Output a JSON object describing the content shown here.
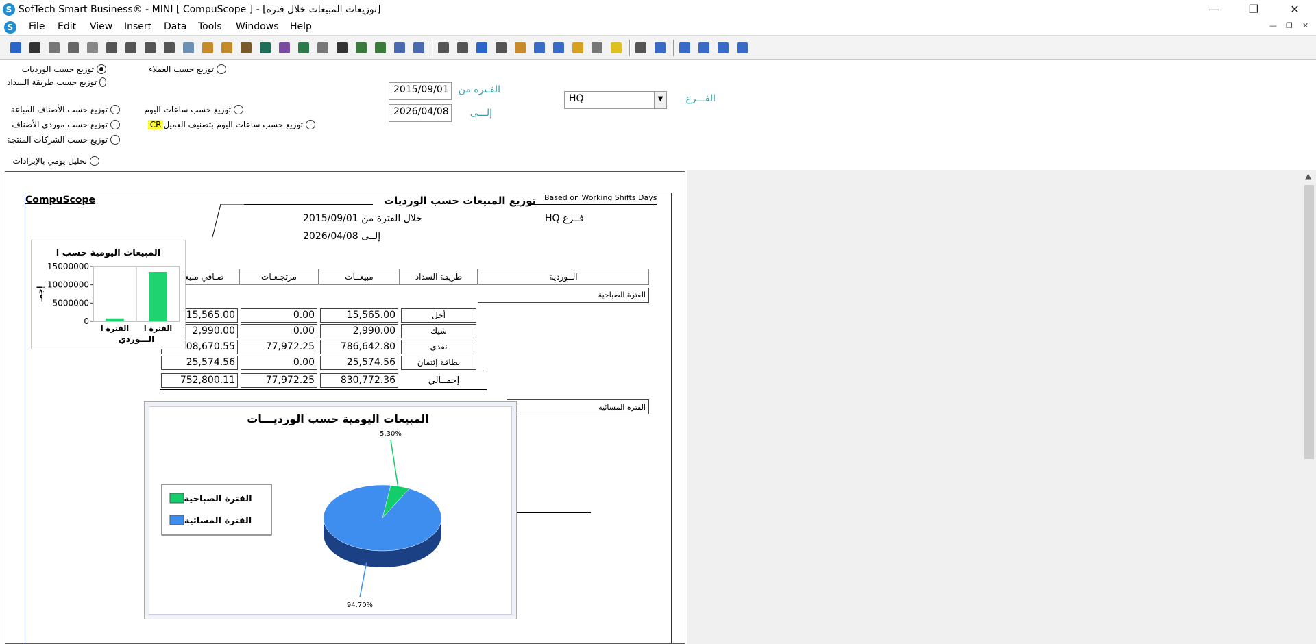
{
  "window": {
    "title": "SofTech Smart Business® - MINI [ CompuScope ]  - [توزيعات المبيعات خلال فترة]",
    "minimize": "—",
    "restore": "❐",
    "close": "✕"
  },
  "menu": {
    "items": [
      "File",
      "Edit",
      "View",
      "Insert",
      "Data",
      "Tools",
      "Windows",
      "Help"
    ],
    "mdi": {
      "min": "—",
      "restore": "❐",
      "close": "✕"
    }
  },
  "toolbar": {
    "colors": [
      "#2a66c8",
      "#333333",
      "#777777",
      "#666666",
      "#888888",
      "#555555",
      "#555555",
      "#555555",
      "#555555",
      "#6b8fb5",
      "#c58a2a",
      "#c58a2a",
      "#7a5a2a",
      "#1f6e5a",
      "#7a4aa0",
      "#2a7a4a",
      "#777777",
      "#333333",
      "#3a7a3a",
      "#3a7a3a",
      "#4a6ab0",
      "#4a6ab0",
      "#555555",
      "#555555",
      "#2a66c8",
      "#555555",
      "#c88a2a",
      "#3a6ac8",
      "#3a6ac8",
      "#d8a020",
      "#777777",
      "#e0c020",
      "#555555",
      "#3a6ac8",
      "#3a6ac8",
      "#3a6ac8",
      "#3a6ac8",
      "#3a6ac8"
    ]
  },
  "options": {
    "by_shifts": "توزيع حسب الورديات",
    "by_customers": "توزيع حسب العملاء",
    "by_payment": "توزيع حسب طريقة السداد",
    "by_items_sold": "توزيع حسب الأصناف المباعة",
    "by_hours": "توزيع حسب ساعات اليوم",
    "by_item_suppliers": "توزيع حسب موردي الأصناف",
    "by_hours_customer_class": "توزيع حسب ساعات اليوم بتصنيف العميل",
    "cr_badge": "CR",
    "by_producing_companies": "توزيع حسب الشركات المنتجة",
    "daily_revenue_analysis": "تحليل يومي بالإيرادات"
  },
  "filters": {
    "period_from_label": "الفـترة من",
    "period_from_value": "2015/09/01",
    "period_to_label": "إلـــى",
    "period_to_value": "2026/04/08",
    "branch_label": "الفـــرع",
    "branch_value": "HQ"
  },
  "report": {
    "company": "CompuScope",
    "title": "توزيع المبيعات حسب الورديات",
    "basis": "Based on Working Shifts Days",
    "period_from_line": "خلال الفترة من 2015/09/01",
    "period_to_line": "إلــى 2026/04/08",
    "branch_line": "فــرع HQ",
    "headers": {
      "shift": "الــوردية",
      "payment_method": "طريقة السداد",
      "sales": "مبيعــات",
      "returns": "مرتجـعـات",
      "net_sales": "صـافي مبيعات"
    },
    "section_morning": "الفترة الصباحية",
    "section_evening": "الفترة المسائية",
    "rows": [
      {
        "method": "أجل",
        "sales": "15,565.00",
        "returns": "0.00",
        "net": "15,565.00"
      },
      {
        "method": "شيك",
        "sales": "2,990.00",
        "returns": "0.00",
        "net": "2,990.00"
      },
      {
        "method": "نقدي",
        "sales": "786,642.80",
        "returns": "77,972.25",
        "net": "708,670.55"
      },
      {
        "method": "بطاقة إئتمان",
        "sales": "25,574.56",
        "returns": "0.00",
        "net": "25,574.56"
      }
    ],
    "total": {
      "label": "إجمــالي",
      "sales": "830,772.36",
      "returns": "77,972.25",
      "net": "752,800.11"
    }
  },
  "chart_data": [
    {
      "type": "bar",
      "title": "المبيعات اليومية حسب ا",
      "xlabel": "الـــوردي",
      "ylabel": "إجمـ",
      "categories": [
        "الفترة ا",
        "الفترة ا"
      ],
      "values": [
        800000,
        13500000
      ],
      "ylim": [
        0,
        15000000
      ],
      "yticks": [
        "15000000",
        "10000000",
        "5000000",
        "0"
      ],
      "color": "#1fd370"
    },
    {
      "type": "pie",
      "title": "المبيعات اليومية حسب الورديـــات",
      "slices": [
        {
          "name": "الفترة الصباحية",
          "value": 5.3,
          "label": "5.30%",
          "color": "#13cc6a"
        },
        {
          "name": "الفترة المسائية",
          "value": 94.7,
          "label": "94.70%",
          "color": "#3e8ef0"
        }
      ],
      "legend": "left"
    }
  ]
}
